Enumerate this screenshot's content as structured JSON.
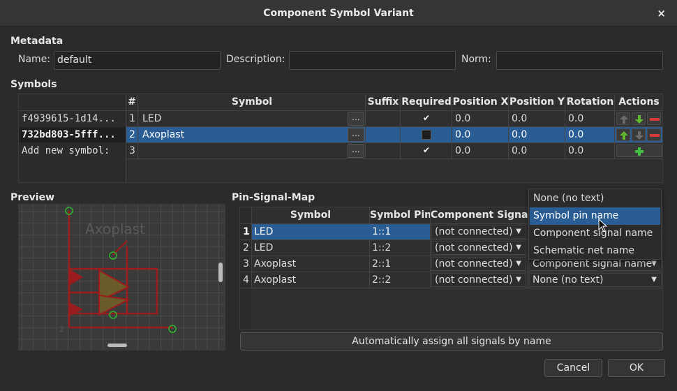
{
  "window": {
    "title": "Component Symbol Variant",
    "close_glyph": "×"
  },
  "metadata": {
    "heading": "Metadata",
    "name_label": "Name:",
    "name_value": "default",
    "description_label": "Description:",
    "description_value": "",
    "norm_label": "Norm:",
    "norm_value": ""
  },
  "symbols": {
    "heading": "Symbols",
    "columns": [
      "#",
      "Symbol",
      "Suffix",
      "Required",
      "Position X",
      "Position Y",
      "Rotation",
      "Actions"
    ],
    "rows": [
      {
        "uuid": "f4939615-1d14...",
        "num": "1",
        "symbol": "LED",
        "suffix": "",
        "required": true,
        "pos_x": "0.0",
        "pos_y": "0.0",
        "rotation": "0.0"
      },
      {
        "uuid": "732bd803-5fff...",
        "num": "2",
        "symbol": "Axoplast",
        "suffix": "",
        "required": false,
        "pos_x": "0.0",
        "pos_y": "0.0",
        "rotation": "0.0"
      },
      {
        "uuid": "Add new symbol:",
        "num": "3",
        "symbol": "",
        "suffix": "",
        "required": true,
        "pos_x": "0.0",
        "pos_y": "0.0",
        "rotation": "0.0"
      }
    ],
    "browse_label": "...",
    "check_glyph": "✔"
  },
  "preview": {
    "heading": "Preview",
    "symbol_name": "Axoplast",
    "pin_number": "2"
  },
  "pin_signal_map": {
    "heading": "Pin-Signal-Map",
    "columns": [
      "Symbol",
      "Symbol Pin",
      "Component Signal"
    ],
    "rows": [
      {
        "num": "1",
        "symbol": "LED",
        "pin": "1::1",
        "signal": "(not connected)",
        "display": ""
      },
      {
        "num": "2",
        "symbol": "LED",
        "pin": "1::2",
        "signal": "(not connected)",
        "display": ""
      },
      {
        "num": "3",
        "symbol": "Axoplast",
        "pin": "2::1",
        "signal": "(not connected)",
        "display": "Component signal name"
      },
      {
        "num": "4",
        "symbol": "Axoplast",
        "pin": "2::2",
        "signal": "(not connected)",
        "display": "None (no text)"
      }
    ],
    "auto_assign_label": "Automatically assign all signals by name"
  },
  "dropdown_popup": {
    "options": [
      "None (no text)",
      "Symbol pin name",
      "Component signal name",
      "Schematic net name"
    ],
    "selected": "Symbol pin name"
  },
  "buttons": {
    "cancel": "Cancel",
    "ok": "OK"
  },
  "colors": {
    "selection": "#2a5d94",
    "up_arrow": "#5fb832",
    "remove": "#d63b3b",
    "add": "#3fc03f",
    "symbol_outline": "#9b1c1c",
    "pin_circle": "#2db82d"
  }
}
